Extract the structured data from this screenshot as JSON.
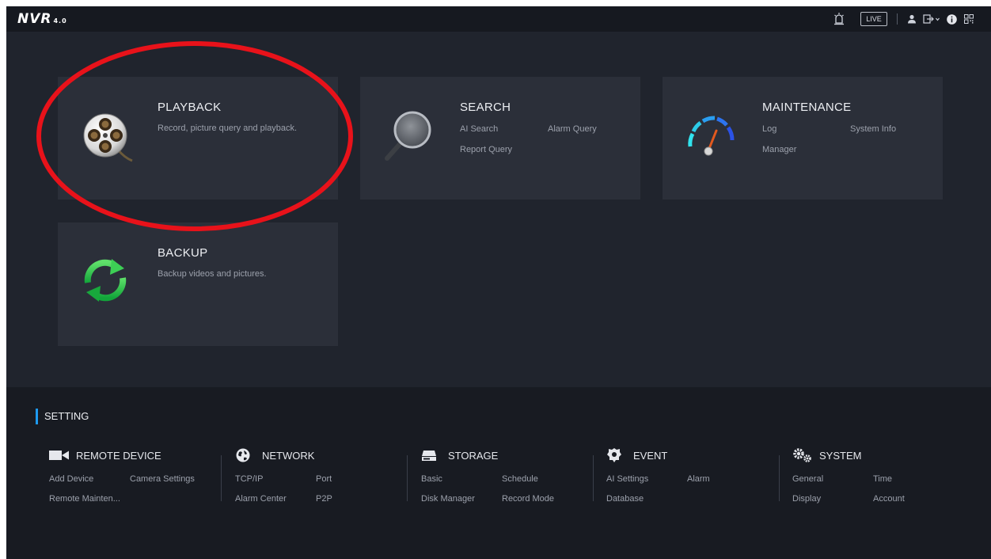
{
  "header": {
    "logo_text": "NVR",
    "logo_version": "4.0",
    "live_label": "LIVE",
    "icons": [
      "alarm-lamp-icon",
      "user-icon",
      "logout-icon",
      "info-icon",
      "qr-code-icon"
    ]
  },
  "cards": {
    "playback": {
      "title": "PLAYBACK",
      "description": "Record, picture query and playback.",
      "icon": "film-reel-icon"
    },
    "search": {
      "title": "SEARCH",
      "links": [
        "AI Search",
        "Alarm Query",
        "Report Query"
      ],
      "icon": "magnifier-icon"
    },
    "maintenance": {
      "title": "MAINTENANCE",
      "links": [
        "Log",
        "System Info",
        "Manager"
      ],
      "icon": "speedometer-icon"
    },
    "backup": {
      "title": "BACKUP",
      "description": "Backup videos and pictures.",
      "icon": "sync-arrows-icon"
    }
  },
  "setting": {
    "title": "SETTING",
    "groups": [
      {
        "title": "REMOTE DEVICE",
        "icon": "camera-icon",
        "links": [
          "Add Device",
          "Camera Settings",
          "Remote Mainten..."
        ]
      },
      {
        "title": "NETWORK",
        "icon": "globe-icon",
        "links": [
          "TCP/IP",
          "Port",
          "Alarm Center",
          "P2P"
        ]
      },
      {
        "title": "STORAGE",
        "icon": "hard-drive-icon",
        "links": [
          "Basic",
          "Schedule",
          "Disk Manager",
          "Record Mode"
        ]
      },
      {
        "title": "EVENT",
        "icon": "event-icon",
        "links": [
          "AI Settings",
          "Alarm",
          "Database"
        ]
      },
      {
        "title": "SYSTEM",
        "icon": "gears-icon",
        "links": [
          "General",
          "Time",
          "Display",
          "Account"
        ]
      }
    ]
  },
  "colors": {
    "accent": "#1e9af0",
    "annotation": "#e8121a",
    "panel": "#2b2f39",
    "background": "#20242d"
  }
}
